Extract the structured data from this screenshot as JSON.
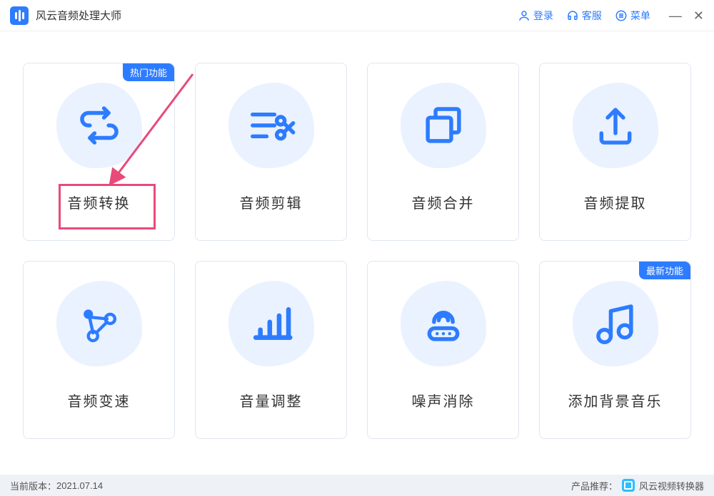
{
  "app": {
    "title": "风云音频处理大师"
  },
  "titlebar": {
    "login": "登录",
    "support": "客服",
    "menu": "菜单"
  },
  "badges": {
    "hot": "热门功能",
    "new": "最新功能"
  },
  "cards": [
    {
      "label": "音频转换",
      "icon": "convert"
    },
    {
      "label": "音频剪辑",
      "icon": "cut"
    },
    {
      "label": "音频合并",
      "icon": "merge"
    },
    {
      "label": "音频提取",
      "icon": "extract"
    },
    {
      "label": "音频变速",
      "icon": "speed"
    },
    {
      "label": "音量调整",
      "icon": "volume"
    },
    {
      "label": "噪声消除",
      "icon": "denoise"
    },
    {
      "label": "添加背景音乐",
      "icon": "bgm"
    }
  ],
  "footer": {
    "version_label": "当前版本：",
    "version": "2021.07.14",
    "recommend_label": "产品推荐：",
    "recommend": "风云视频转换器"
  },
  "annotation": {
    "highlight_target": 0
  }
}
